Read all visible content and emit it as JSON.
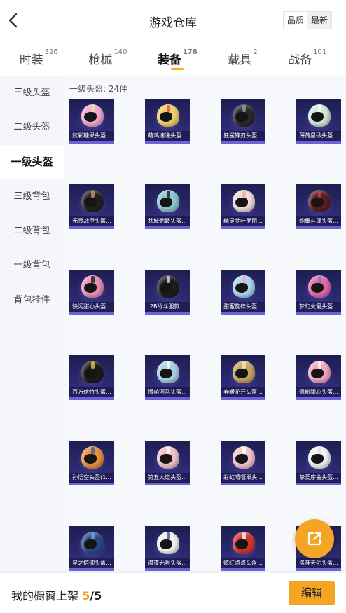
{
  "header": {
    "title": "游戏仓库",
    "sort_options": [
      {
        "label": "品质",
        "active": true
      },
      {
        "label": "最新",
        "active": false
      }
    ]
  },
  "tabs": [
    {
      "label": "时装",
      "count": "326",
      "active": false
    },
    {
      "label": "枪械",
      "count": "140",
      "active": false
    },
    {
      "label": "装备",
      "count": "178",
      "active": true
    },
    {
      "label": "载具",
      "count": "2",
      "active": false
    },
    {
      "label": "战备",
      "count": "101",
      "active": false
    }
  ],
  "sidebar": {
    "items": [
      {
        "label": "三级头盔",
        "active": false
      },
      {
        "label": "二级头盔",
        "active": false
      },
      {
        "label": "一级头盔",
        "active": true
      },
      {
        "label": "三级背包",
        "active": false
      },
      {
        "label": "二级背包",
        "active": false
      },
      {
        "label": "一级背包",
        "active": false
      },
      {
        "label": "背包挂件",
        "active": false
      }
    ]
  },
  "section": {
    "title": "一级头盔: 24件"
  },
  "items": [
    {
      "name": "炫彩糖果头盔...",
      "color": "#f3a6cf",
      "accent": "#f0e0a0"
    },
    {
      "name": "萌鸡速递头盔...",
      "color": "#f2cf6a",
      "accent": "#e05050"
    },
    {
      "name": "狂鲨锋刃头盔...",
      "color": "#2a2a2a",
      "accent": "#9aa0a8"
    },
    {
      "name": "薄荷星砂头盔...",
      "color": "#cfe8d3",
      "accent": "#ffffff"
    },
    {
      "name": "无畏战甲头盔...",
      "color": "#222222",
      "accent": "#c89a6a"
    },
    {
      "name": "共城骷髅头盔...",
      "color": "#8ec5cf",
      "accent": "#1a1a1a"
    },
    {
      "name": "精灵梦叶罗丽...",
      "color": "#f2dcdc",
      "accent": "#e7b0a0"
    },
    {
      "name": "炮鹰斗篷头盔...",
      "color": "#5a1e25",
      "accent": "#c04050"
    },
    {
      "name": "快闪甜心头盔...",
      "color": "#e98fb8",
      "accent": "#1a1a1a"
    },
    {
      "name": "2B战斗服款...",
      "color": "#1d1d1d",
      "accent": "#dddddd"
    },
    {
      "name": "甜蜜旋律头盔...",
      "color": "#a9d4ef",
      "accent": "#f3a6cf"
    },
    {
      "name": "梦幻火箭头盔...",
      "color": "#e26aa8",
      "accent": "#6a7ae0"
    },
    {
      "name": "百万伏特头盔...",
      "color": "#1c1c1c",
      "accent": "#f0c040"
    },
    {
      "name": "懵萌河马头盔...",
      "color": "#a9cfe6",
      "accent": "#ffffff"
    },
    {
      "name": "春暖花开头盔...",
      "color": "#c9a460",
      "accent": "#f1e6c8"
    },
    {
      "name": "佩粉甜心头盔...",
      "color": "#f2a7c0",
      "accent": "#ffffff"
    },
    {
      "name": "孙悟空头盔(1...",
      "color": "#e7903a",
      "accent": "#3a5a9a"
    },
    {
      "name": "第五大道头盔...",
      "color": "#f1c0c8",
      "accent": "#ffffff"
    },
    {
      "name": "彩虹嘻嘻猴头...",
      "color": "#f4c4cc",
      "accent": "#ffffff"
    },
    {
      "name": "挚爱序曲头盔...",
      "color": "#f2f2f2",
      "accent": "#dddddd"
    },
    {
      "name": "星之信仰头盔...",
      "color": "#2b4a8a",
      "accent": "#6fa0e0"
    },
    {
      "name": "浪夜无限头盔...",
      "color": "#f2f2f2",
      "accent": "#3a4ab0"
    },
    {
      "name": "炫红点点头盔...",
      "color": "#d7332e",
      "accent": "#ffffff"
    },
    {
      "name": "洛神天佑头盔...",
      "color": "#c8a06a",
      "accent": "#3a2a1a"
    }
  ],
  "footer": {
    "label": "我的橱窗上架",
    "current": "5",
    "separator": "/",
    "total": "5",
    "edit_label": "编辑"
  },
  "colors": {
    "accent": "#f5a524",
    "card_bg": "#2c2a72",
    "card_border": "#6c63d9"
  },
  "icons": {
    "back": "chevron-left-icon",
    "fab": "share-external-icon"
  }
}
